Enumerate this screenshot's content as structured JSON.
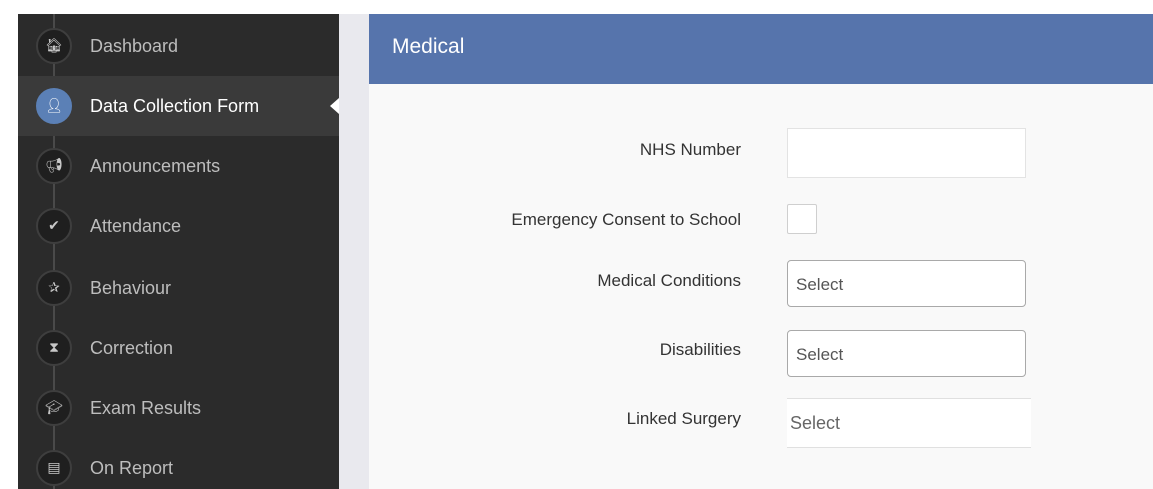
{
  "sidebar": {
    "items": [
      {
        "label": "Dashboard",
        "icon": "home-icon",
        "glyph": "🏠︎",
        "active": false
      },
      {
        "label": "Data Collection Form",
        "icon": "user-icon",
        "glyph": "👤︎",
        "active": true
      },
      {
        "label": "Announcements",
        "icon": "bullhorn-icon",
        "glyph": "📢︎",
        "active": false
      },
      {
        "label": "Attendance",
        "icon": "check-icon",
        "glyph": "✔",
        "active": false
      },
      {
        "label": "Behaviour",
        "icon": "star-icon",
        "glyph": "✰",
        "active": false
      },
      {
        "label": "Correction",
        "icon": "hourglass-icon",
        "glyph": "⧗",
        "active": false
      },
      {
        "label": "Exam Results",
        "icon": "graduation-cap-icon",
        "glyph": "🎓︎",
        "active": false
      },
      {
        "label": "On Report",
        "icon": "document-icon",
        "glyph": "▤",
        "active": false
      }
    ]
  },
  "panel": {
    "title": "Medical",
    "fields": {
      "nhs_number": {
        "label": "NHS Number",
        "value": ""
      },
      "emergency_consent": {
        "label": "Emergency Consent to School",
        "checked": false
      },
      "medical_conditions": {
        "label": "Medical Conditions",
        "value": "Select"
      },
      "disabilities": {
        "label": "Disabilities",
        "value": "Select"
      },
      "linked_surgery": {
        "label": "Linked Surgery",
        "value": "Select"
      }
    }
  },
  "colors": {
    "sidebar_bg": "#2b2b2b",
    "active_item_bg": "#3a3a3a",
    "active_icon": "#5b80b6",
    "header_bg": "#5674ac"
  }
}
